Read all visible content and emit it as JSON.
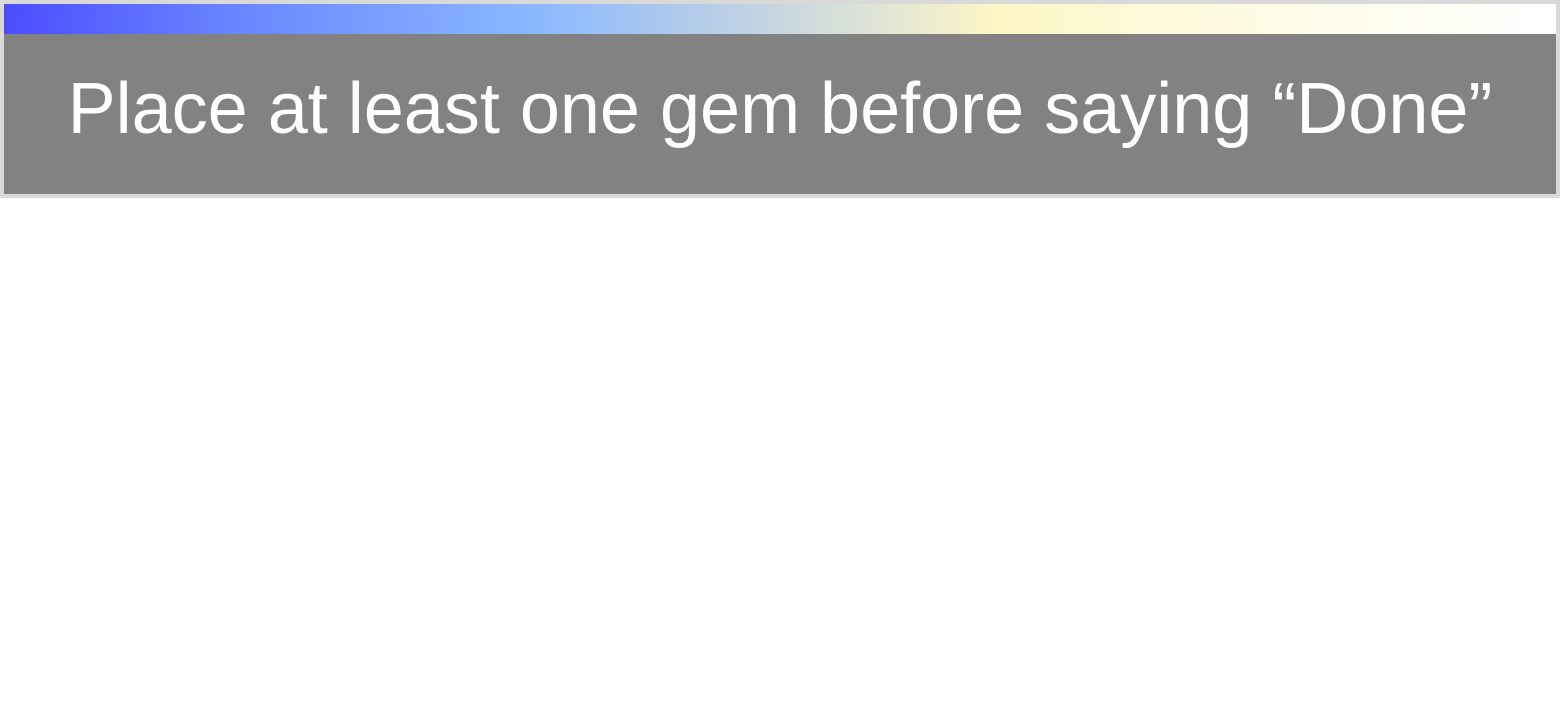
{
  "dialog": {
    "message": "Place at least one gem before saying “Done”",
    "colors": {
      "background": "#828282",
      "border": "#d9d9d9",
      "text": "#ffffff",
      "gradient": [
        "#4a4dff",
        "#8ab8ff",
        "#fdf6c6",
        "#ffffff"
      ]
    }
  }
}
